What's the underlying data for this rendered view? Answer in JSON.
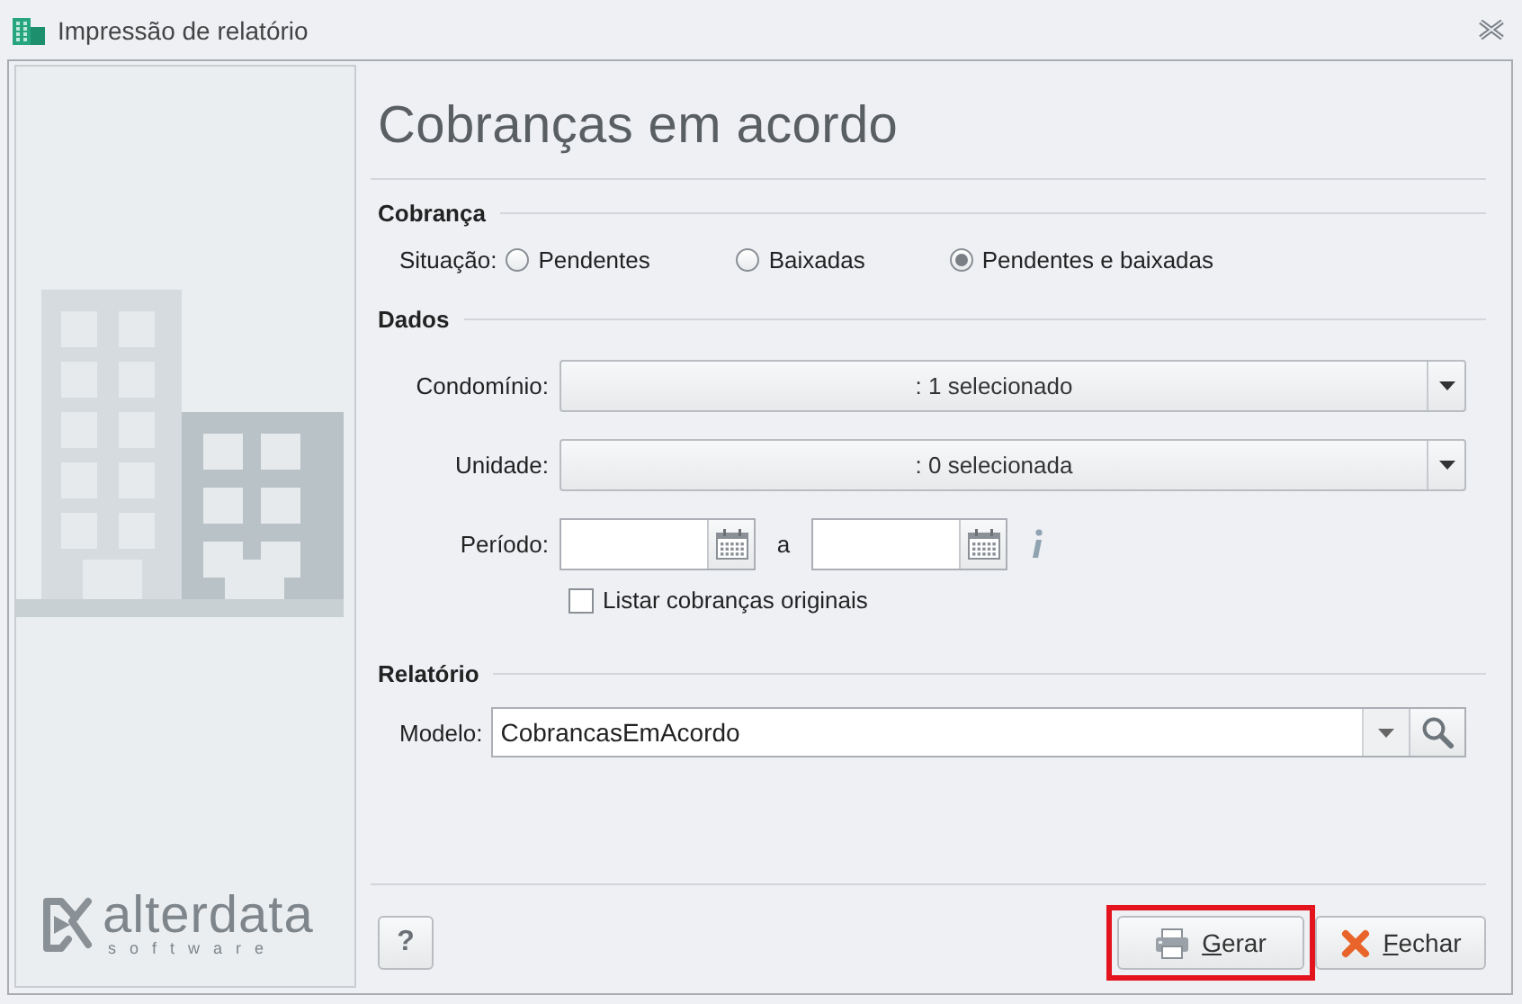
{
  "window": {
    "title": "Impressão de relatório"
  },
  "sidebar": {
    "logo": {
      "name": "alterdata",
      "tagline": "software"
    }
  },
  "header": "Cobranças em acordo",
  "cobranca": {
    "title": "Cobrança",
    "label": "Situação:",
    "options": [
      {
        "label": "Pendentes",
        "selected": false
      },
      {
        "label": "Baixadas",
        "selected": false
      },
      {
        "label": "Pendentes e baixadas",
        "selected": true
      }
    ]
  },
  "dados": {
    "title": "Dados",
    "condominio": {
      "label": "Condomínio:",
      "value": ": 1 selecionado"
    },
    "unidade": {
      "label": "Unidade:",
      "value": ": 0 selecionada"
    },
    "periodo": {
      "label": "Período:",
      "separator": "a"
    },
    "listar": {
      "label": "Listar cobranças originais",
      "checked": false
    }
  },
  "relatorio": {
    "title": "Relatório",
    "modelo": {
      "label": "Modelo:",
      "value": "CobrancasEmAcordo"
    }
  },
  "buttons": [
    {
      "label": "?",
      "kind": "help",
      "highlighted": false
    },
    {
      "label": "Gerar",
      "kind": "print",
      "highlighted": true
    },
    {
      "label": "Fechar",
      "kind": "close",
      "highlighted": false
    }
  ]
}
